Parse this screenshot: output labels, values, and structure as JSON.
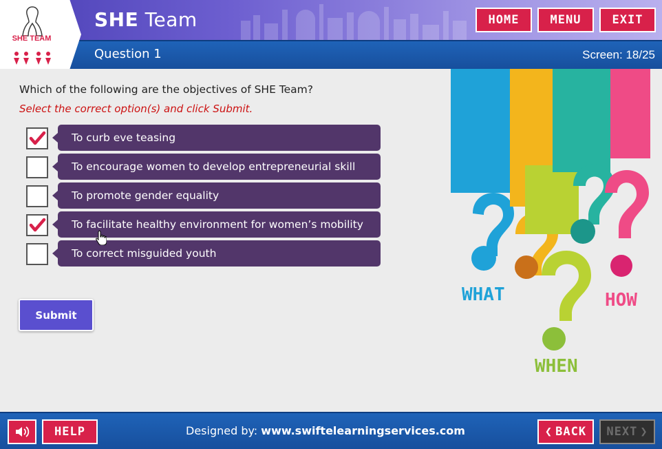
{
  "header": {
    "logo_text": "SHE TEAM",
    "title_bold": "SHE",
    "title_rest": "Team",
    "question_label": "Question 1",
    "screen_label": "Screen:",
    "screen_value": "18/25",
    "buttons": {
      "home": "HOME",
      "menu": "MENU",
      "exit": "EXIT"
    }
  },
  "main": {
    "question": "Which of the following are the objectives of SHE Team?",
    "instruction": "Select the correct option(s) and click Submit.",
    "options": [
      {
        "label": "To curb eve teasing",
        "checked": true
      },
      {
        "label": "To encourage women to develop entrepreneurial skill",
        "checked": false
      },
      {
        "label": "To promote gender equality",
        "checked": false
      },
      {
        "label": "To facilitate healthy environment for women’s mobility",
        "checked": true
      },
      {
        "label": "To correct misguided youth",
        "checked": false
      }
    ],
    "submit_label": "Submit"
  },
  "illustration": {
    "words": [
      "WHAT",
      "WHEN",
      "HOW"
    ],
    "colors": [
      "#1fa2d8",
      "#f3b51c",
      "#b9d233",
      "#27b3a0",
      "#ef4b86"
    ]
  },
  "footer": {
    "help_label": "HELP",
    "designed_prefix": "Designed by:",
    "designed_url": "www.swiftelearningservices.com",
    "back_label": "BACK",
    "next_label": "NEXT"
  },
  "colors": {
    "accent": "#d8214a",
    "header_blue": "#1f63b8",
    "option_bg": "#52366a",
    "submit_bg": "#5a4fcf",
    "instruction_red": "#cc1111"
  }
}
